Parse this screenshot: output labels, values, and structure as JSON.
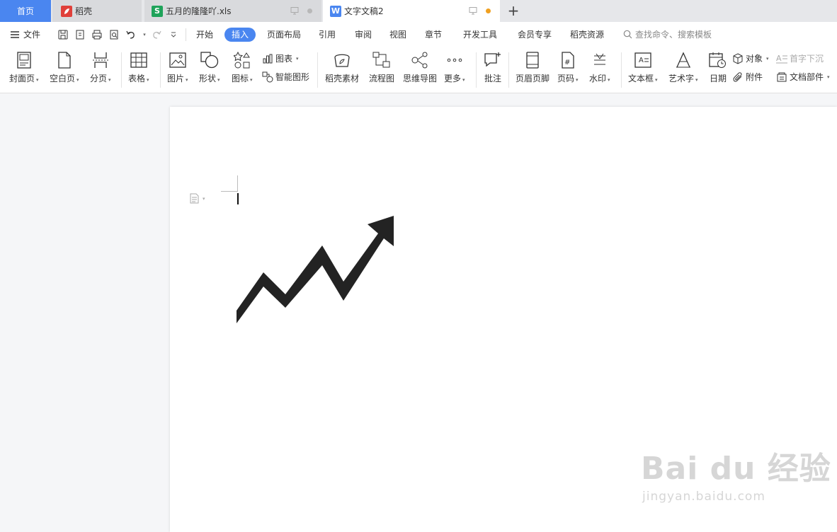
{
  "tabs": {
    "home": "首页",
    "docer": "稻壳",
    "xls": "五月的隆隆吖.xls",
    "doc": "文字文稿2"
  },
  "menu": {
    "file": "文件",
    "tabs": [
      "开始",
      "插入",
      "页面布局",
      "引用",
      "审阅",
      "视图",
      "章节",
      "开发工具",
      "会员专享",
      "稻壳资源"
    ],
    "active_tab": "插入",
    "search": "查找命令、搜索模板"
  },
  "ribbon": {
    "cover": "封面页",
    "blank": "空白页",
    "pagebreak": "分页",
    "table": "表格",
    "picture": "图片",
    "shape": "形状",
    "icons": "图标",
    "chart": "图表",
    "smart": "智能图形",
    "docer_material": "稻壳素材",
    "flowchart": "流程图",
    "mindmap": "思维导图",
    "more": "更多",
    "comment": "批注",
    "header_footer": "页眉页脚",
    "page_number": "页码",
    "watermark": "水印",
    "textbox": "文本框",
    "wordart": "艺术字",
    "date": "日期",
    "object": "对象",
    "attachment": "附件",
    "dropcap": "首字下沉",
    "doc_parts": "文档部件"
  },
  "watermark": {
    "main": "Bai du 经验",
    "sub": "jingyan.baidu.com"
  },
  "colors": {
    "accent": "#4a86f0",
    "docer_red": "#e0403a",
    "xls_green": "#1fa35a",
    "doc_blue": "#4a86f0",
    "unsaved_dot": "#f0a020"
  }
}
